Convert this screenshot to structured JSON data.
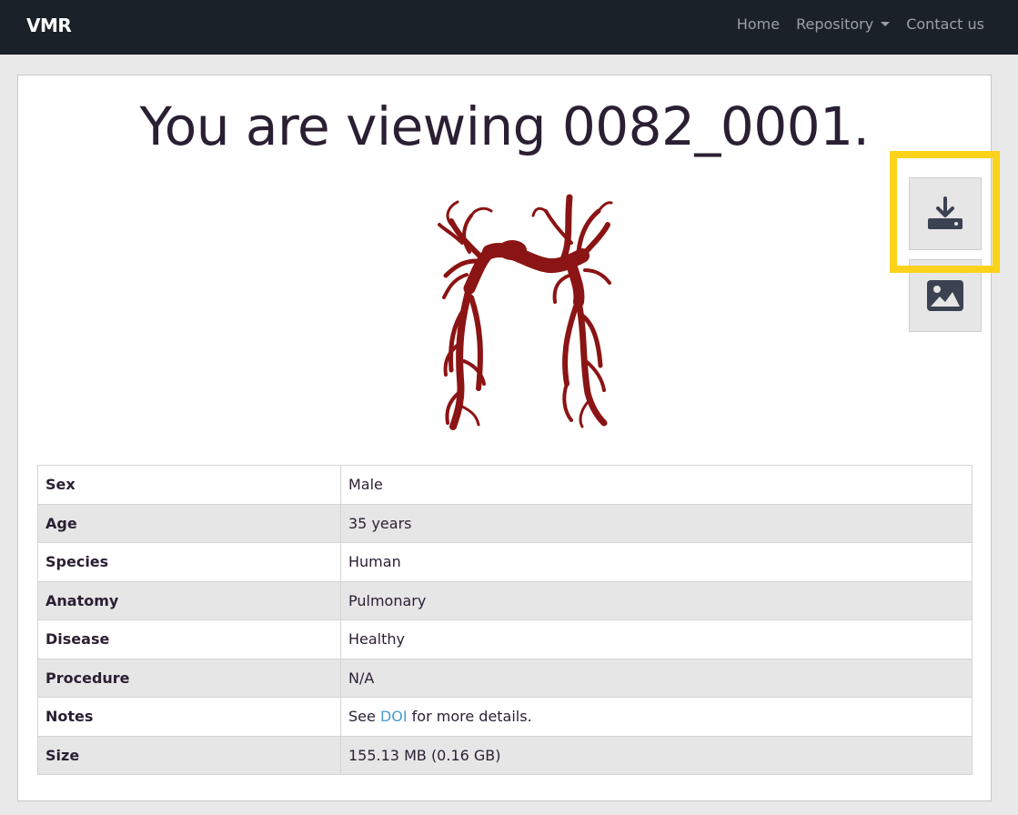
{
  "navbar": {
    "brand": "VMR",
    "links": [
      {
        "label": "Home"
      },
      {
        "label": "Repository",
        "dropdown": true
      },
      {
        "label": "Contact us"
      }
    ]
  },
  "main": {
    "title": "You are viewing 0082_0001.",
    "model_color": "#8b1414",
    "actions": {
      "download_icon": "download-icon",
      "image_icon": "image-icon"
    },
    "highlight_color": "#fad21a",
    "table": {
      "rows": [
        {
          "key": "Sex",
          "value": "Male"
        },
        {
          "key": "Age",
          "value": "35 years"
        },
        {
          "key": "Species",
          "value": "Human"
        },
        {
          "key": "Anatomy",
          "value": "Pulmonary"
        },
        {
          "key": "Disease",
          "value": "Healthy"
        },
        {
          "key": "Procedure",
          "value": "N/A"
        },
        {
          "key": "Notes",
          "value_prefix": "See ",
          "value_link": "DOI",
          "value_suffix": " for more details."
        },
        {
          "key": "Size",
          "value": "155.13 MB (0.16 GB)"
        }
      ]
    }
  }
}
